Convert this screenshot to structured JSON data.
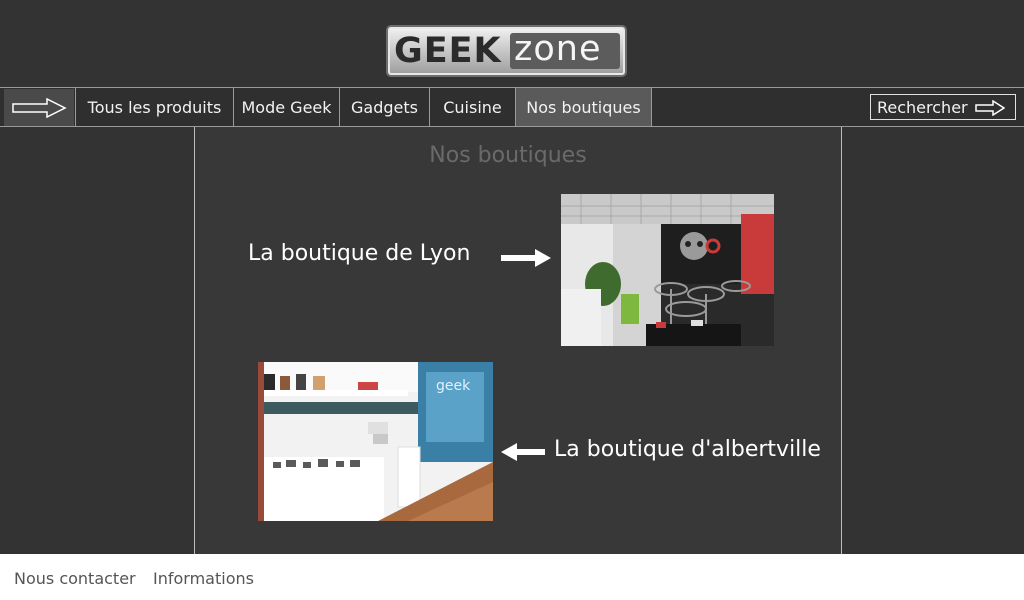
{
  "header": {
    "logo_part1": "GEEK",
    "logo_part2": "zone"
  },
  "nav": {
    "back_icon": "arrow-right-icon",
    "items": [
      {
        "label": "Tous les produits"
      },
      {
        "label": "Mode Geek"
      },
      {
        "label": "Gadgets"
      },
      {
        "label": "Cuisine"
      },
      {
        "label": "Nos boutiques",
        "active": true
      }
    ],
    "search_label": "Rechercher",
    "search_icon": "arrow-right-icon"
  },
  "main": {
    "title": "Nos boutiques",
    "stores": [
      {
        "label": "La boutique de Lyon",
        "photo": "lyon-store-photo"
      },
      {
        "label": "La boutique d'albertville",
        "photo": "albertville-store-photo"
      }
    ]
  },
  "footer": {
    "contact_label": "Nous contacter",
    "info_label": "Informations"
  },
  "colors": {
    "background": "#333333",
    "panel": "#383838",
    "active_tab": "#5a5a5a",
    "footer": "#ffffff"
  }
}
